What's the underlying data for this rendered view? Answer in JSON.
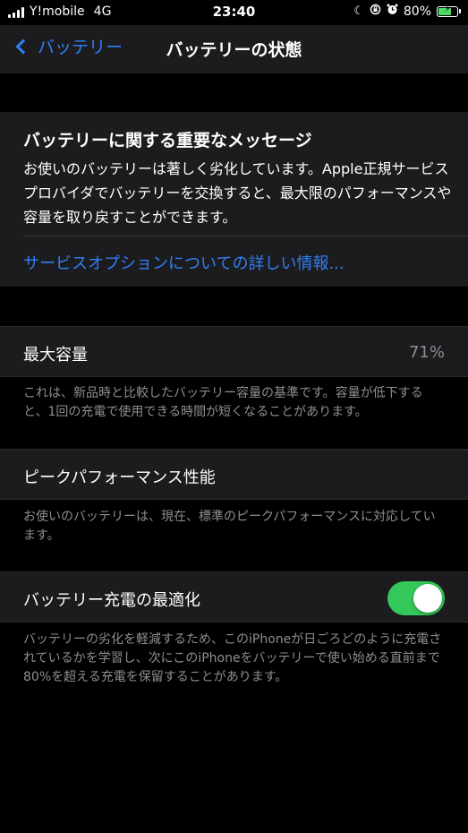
{
  "status_bar": {
    "carrier": "Y!mobile",
    "network": "4G",
    "time": "23:40",
    "battery_percent": "80%",
    "battery_level": 0.8,
    "icons": [
      "signal-icon",
      "moon-icon",
      "orientation-lock-icon",
      "alarm-icon",
      "battery-charging-icon"
    ]
  },
  "nav": {
    "back_label": "バッテリー",
    "title": "バッテリーの状態"
  },
  "message": {
    "title": "バッテリーに関する重要なメッセージ",
    "body": "お使いのバッテリーは著しく劣化しています。Apple正規サービスプロバイダでバッテリーを交換すると、最大限のパフォーマンスや容量を取り戻すことができます。",
    "link": "サービスオプションについての詳しい情報..."
  },
  "max_capacity": {
    "label": "最大容量",
    "value": "71%",
    "footnote": "これは、新品時と比較したバッテリー容量の基準です。容量が低下すると、1回の充電で使用できる時間が短くなることがあります。"
  },
  "peak_performance": {
    "label": "ピークパフォーマンス性能",
    "footnote": "お使いのバッテリーは、現在、標準のピークパフォーマンスに対応しています。"
  },
  "optimized_charging": {
    "label": "バッテリー充電の最適化",
    "enabled": true,
    "footnote": "バッテリーの劣化を軽減するため、このiPhoneが日ごろどのように充電されているかを学習し、次にこのiPhoneをバッテリーで使い始める直前まで80%を超える充電を保留することがあります。"
  },
  "colors": {
    "background": "#000000",
    "cell": "#1c1c1e",
    "accent": "#2f7ff5",
    "toggle_on": "#34c759",
    "secondary_text": "#8e8e93"
  }
}
